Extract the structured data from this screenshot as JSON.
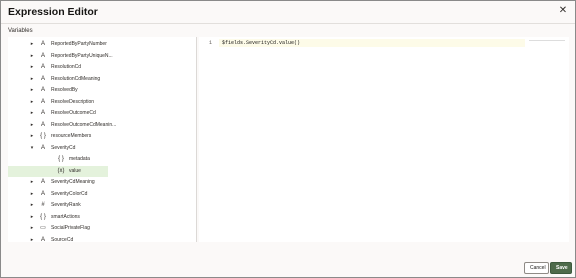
{
  "dialog": {
    "title": "Expression Editor",
    "close_icon": "close-icon"
  },
  "variables": {
    "label": "Variables",
    "items": [
      {
        "name": "ReportedByPartyNumber",
        "icon": "A",
        "expand": "▸"
      },
      {
        "name": "ReportedByPartyUniqueN...",
        "icon": "A",
        "expand": "▸"
      },
      {
        "name": "ResolutionCd",
        "icon": "A",
        "expand": "▸"
      },
      {
        "name": "ResolutionCdMeaning",
        "icon": "A",
        "expand": "▸"
      },
      {
        "name": "ResolvedBy",
        "icon": "A",
        "expand": "▸"
      },
      {
        "name": "ResolveDescription",
        "icon": "A",
        "expand": "▸"
      },
      {
        "name": "ResolveOutcomeCd",
        "icon": "A",
        "expand": "▸"
      },
      {
        "name": "ResolveOutcomeCdMeanin...",
        "icon": "A",
        "expand": "▸"
      },
      {
        "name": "resourceMembers",
        "icon": "{ }",
        "expand": "▸"
      },
      {
        "name": "SeverityCd",
        "icon": "A",
        "expand": "▾"
      },
      {
        "name": "metadata",
        "icon": "{ }",
        "expand": "",
        "child": true
      },
      {
        "name": "value",
        "icon": "(x)",
        "expand": "",
        "child": true,
        "selected": true
      },
      {
        "name": "SeverityCdMeaning",
        "icon": "A",
        "expand": "▸"
      },
      {
        "name": "SeverityColorCd",
        "icon": "A",
        "expand": "▸"
      },
      {
        "name": "SeverityRank",
        "icon": "#",
        "expand": "▸"
      },
      {
        "name": "smartActions",
        "icon": "{ }",
        "expand": "▸"
      },
      {
        "name": "SocialPrivateFlag",
        "icon": "▭",
        "expand": "▸"
      },
      {
        "name": "SourceCd",
        "icon": "A",
        "expand": "▸"
      }
    ]
  },
  "editor": {
    "line_number": "1",
    "code": "$fields.SeverityCd.value()"
  },
  "footer": {
    "cancel_label": "Cancel",
    "save_label": "Save"
  },
  "colors": {
    "save_button": "#4e6b4b",
    "selected_row": "#e4f2dc",
    "current_line": "#fdfbe8"
  }
}
